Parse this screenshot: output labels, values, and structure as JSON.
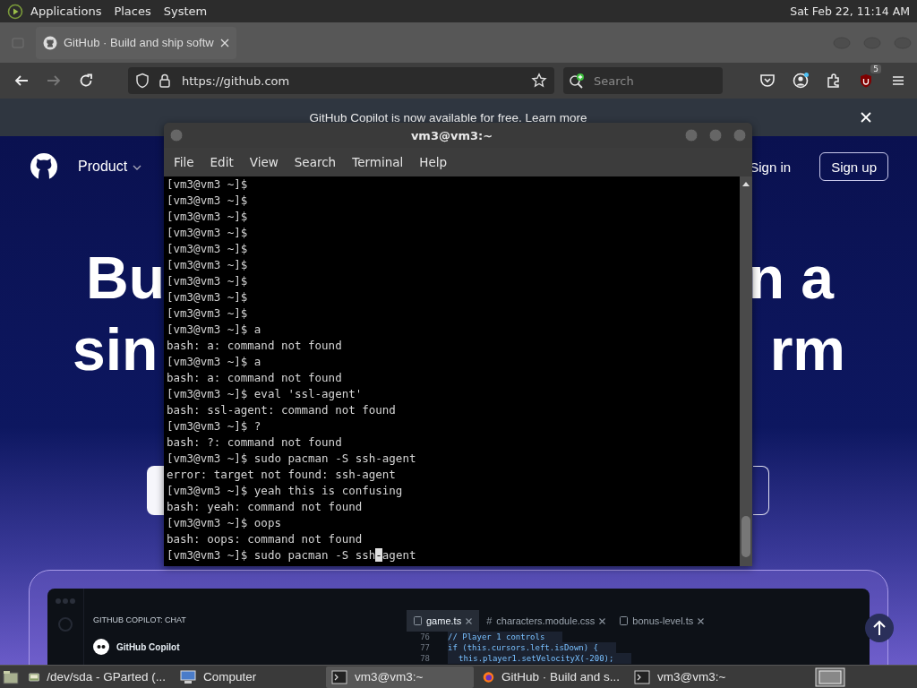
{
  "top_panel": {
    "menus": [
      "Applications",
      "Places",
      "System"
    ],
    "clock": "Sat Feb 22, 11:14 AM"
  },
  "browser": {
    "tabs": [
      {
        "title": "GitHub · Build and ship softw",
        "selected": true
      }
    ],
    "url": "https://github.com",
    "search": {
      "placeholder": "Search"
    },
    "extension_badge": "5",
    "banner": {
      "text": "GitHub Copilot is now available for free.",
      "link": "Learn more"
    }
  },
  "page": {
    "nav": [
      {
        "label": "Product",
        "dropdown": true
      }
    ],
    "sign_in": "Sign in",
    "sign_up": "Sign up",
    "hero_lines": [
      {
        "left": "Bu",
        "right": "n a"
      },
      {
        "left": "sin",
        "right": "rm"
      }
    ],
    "editor": {
      "panel_title": "GITHUB COPILOT: CHAT",
      "assistant": "GitHub Copilot",
      "tabs": [
        {
          "kind": "ts",
          "name": "game.ts",
          "selected": true
        },
        {
          "kind": "css",
          "glyph": "#",
          "name": "characters.module.css",
          "selected": false
        },
        {
          "kind": "ts",
          "name": "bonus-level.ts",
          "selected": false
        }
      ],
      "code": [
        {
          "line": "76",
          "text": "// Player 1 controls",
          "indent": false
        },
        {
          "line": "77",
          "text": "if (this.cursors.left.isDown) {",
          "indent": false
        },
        {
          "line": "78",
          "text": "this.player1.setVelocityX(-200);",
          "indent": true
        }
      ]
    }
  },
  "terminal": {
    "title": "vm3@vm3:~",
    "menus": [
      "File",
      "Edit",
      "View",
      "Search",
      "Terminal",
      "Help"
    ],
    "lines": [
      "[vm3@vm3 ~]$",
      "[vm3@vm3 ~]$",
      "[vm3@vm3 ~]$",
      "[vm3@vm3 ~]$",
      "[vm3@vm3 ~]$",
      "[vm3@vm3 ~]$",
      "[vm3@vm3 ~]$",
      "[vm3@vm3 ~]$",
      "[vm3@vm3 ~]$",
      "[vm3@vm3 ~]$ a",
      "bash: a: command not found",
      "[vm3@vm3 ~]$ a",
      "bash: a: command not found",
      "[vm3@vm3 ~]$ eval 'ssl-agent'",
      "bash: ssl-agent: command not found",
      "[vm3@vm3 ~]$ ?",
      "bash: ?: command not found",
      "[vm3@vm3 ~]$ sudo pacman -S ssh-agent",
      "error: target not found: ssh-agent",
      "[vm3@vm3 ~]$ yeah this is confusing",
      "bash: yeah: command not found",
      "[vm3@vm3 ~]$ oops",
      "bash: oops: command not found"
    ],
    "input_line": {
      "before_cursor": "[vm3@vm3 ~]$ sudo pacman -S ssh",
      "at_cursor": "-",
      "after_cursor": "agent"
    }
  },
  "taskbar": {
    "items": [
      {
        "kind": "disk",
        "label": "/dev/sda - GParted (...",
        "selected": false
      },
      {
        "kind": "computer",
        "label": "Computer",
        "selected": false
      },
      {
        "kind": "terminal",
        "label": "vm3@vm3:~",
        "selected": true
      },
      {
        "kind": "browser",
        "label": "GitHub · Build and s...",
        "selected": false
      },
      {
        "kind": "terminal",
        "label": "vm3@vm3:~",
        "selected": false
      }
    ]
  }
}
